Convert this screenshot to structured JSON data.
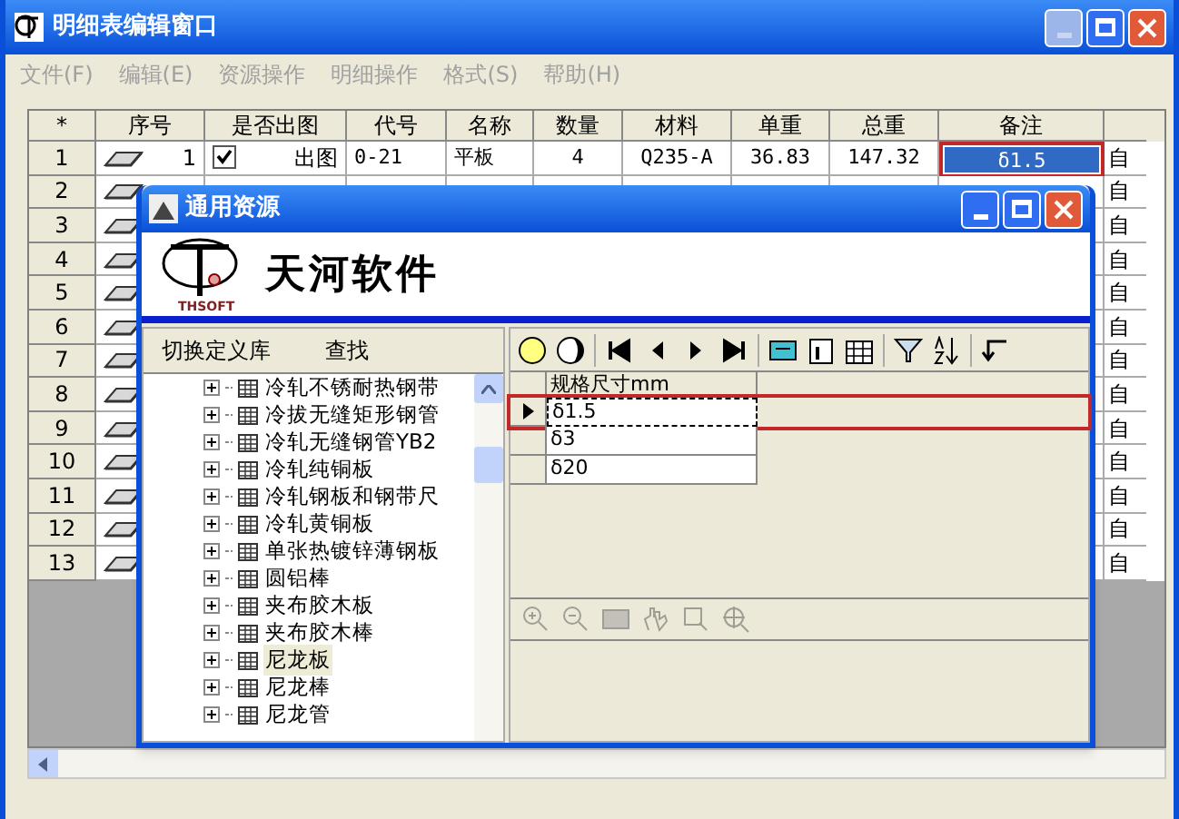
{
  "window": {
    "title": "明细表编辑窗口",
    "minimize_disabled": true
  },
  "menu": [
    {
      "label": "文件(F)",
      "disabled": true
    },
    {
      "label": "编辑(E)",
      "disabled": true
    },
    {
      "label": "资源操作",
      "disabled": true
    },
    {
      "label": "明细操作",
      "disabled": true
    },
    {
      "label": "格式(S)",
      "disabled": true
    },
    {
      "label": "帮助(H)",
      "disabled": true
    }
  ],
  "table": {
    "columns": [
      "*",
      "序号",
      "是否出图",
      "代号",
      "名称",
      "数量",
      "材料",
      "单重",
      "总重",
      "备注"
    ],
    "rows": [
      {
        "row": "1",
        "seq": "1",
        "drawing_checked": true,
        "drawing": "出图",
        "code": "0-21",
        "name": "平板",
        "qty": "4",
        "material": "Q235-A",
        "unit_weight": "36.83",
        "total_weight": "147.32",
        "remark": "δ1.5",
        "selected": true,
        "column_11": "自"
      },
      {
        "row": "2",
        "selected": false,
        "column_11": "自"
      },
      {
        "row": "3",
        "selected": false,
        "column_11": "自"
      },
      {
        "row": "4",
        "selected": false,
        "column_11": "自"
      },
      {
        "row": "5",
        "selected": false,
        "column_11": "自"
      },
      {
        "row": "6",
        "selected": false,
        "column_11": "自"
      },
      {
        "row": "7",
        "selected": false,
        "column_11": "自"
      },
      {
        "row": "8",
        "selected": false,
        "column_11": "自"
      },
      {
        "row": "9",
        "selected": false,
        "column_11": "自"
      },
      {
        "row": "10",
        "selected": false,
        "column_11": "自"
      },
      {
        "row": "11",
        "selected": false,
        "column_11": "自"
      },
      {
        "row": "12",
        "selected": false,
        "column_11": "自"
      },
      {
        "row": "13",
        "selected": false,
        "column_11": "自"
      }
    ]
  },
  "dialog": {
    "title": "通用资源",
    "logo_mark": "THSOFT",
    "logo_text": "天河软件",
    "left_toolbar": [
      "切换定义库",
      "查找"
    ],
    "tree": [
      {
        "label": "冷轧不锈耐热钢带",
        "expanded": false,
        "selected": false
      },
      {
        "label": "冷拔无缝矩形钢管",
        "expanded": false,
        "selected": false
      },
      {
        "label": "冷轧无缝钢管YB2",
        "expanded": false,
        "selected": false
      },
      {
        "label": "冷轧纯铜板",
        "expanded": false,
        "selected": false
      },
      {
        "label": "冷轧钢板和钢带尺",
        "expanded": false,
        "selected": false
      },
      {
        "label": "冷轧黄铜板",
        "expanded": false,
        "selected": false
      },
      {
        "label": "单张热镀锌薄钢板",
        "expanded": false,
        "selected": false
      },
      {
        "label": "圆铝棒",
        "expanded": false,
        "selected": false
      },
      {
        "label": "夹布胶木板",
        "expanded": false,
        "selected": false
      },
      {
        "label": "夹布胶木棒",
        "expanded": false,
        "selected": false
      },
      {
        "label": "尼龙板",
        "expanded": false,
        "selected": true
      },
      {
        "label": "尼龙棒",
        "expanded": false,
        "selected": false
      },
      {
        "label": "尼龙管",
        "expanded": false,
        "selected": false
      }
    ],
    "grid": {
      "column": "规格尺寸mm",
      "rows": [
        {
          "value": "δ1.5",
          "selected": true
        },
        {
          "value": "δ3",
          "selected": false
        },
        {
          "value": "δ20",
          "selected": false
        }
      ]
    },
    "zoom_toolbar_disabled": true
  }
}
